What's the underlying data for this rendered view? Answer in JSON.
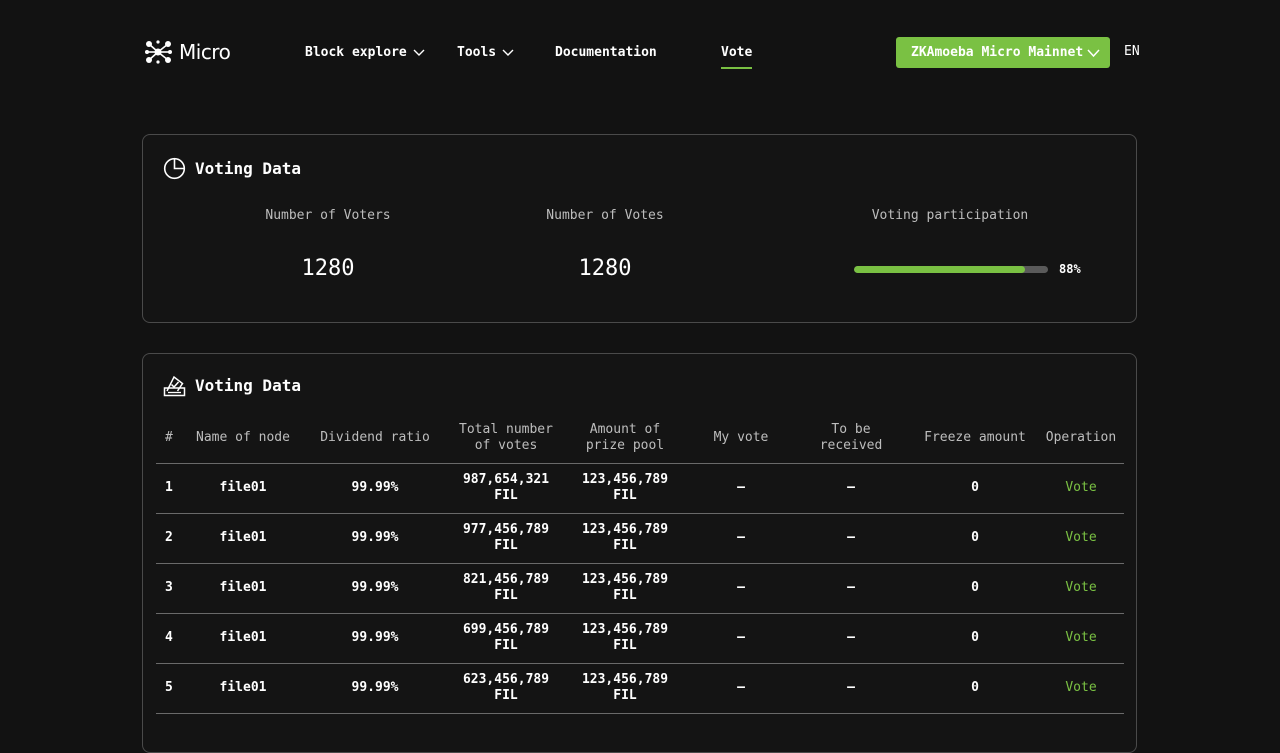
{
  "brand": {
    "name": "Micro"
  },
  "nav": {
    "block_explore": "Block explore",
    "tools": "Tools",
    "documentation": "Documentation",
    "vote": "Vote"
  },
  "network": {
    "selected": "ZKAmoeba Micro Mainnet"
  },
  "language": "EN",
  "colors": {
    "accent": "#7ac143",
    "background": "#121212",
    "border": "#4a4a4a"
  },
  "summary": {
    "title": "Voting Data",
    "icon": "pie-chart-icon",
    "voters_label": "Number of Voters",
    "voters_value": "1280",
    "votes_label": "Number of Votes",
    "votes_value": "1280",
    "participation_label": "Voting participation",
    "participation_percent": 88,
    "participation_text": "88%"
  },
  "table": {
    "title": "Voting Data",
    "icon": "ballot-box-icon",
    "columns": {
      "idx": "#",
      "name": "Name of node",
      "dividend": "Dividend ratio",
      "total_votes_1": "Total number",
      "total_votes_2": "of votes",
      "prize_1": "Amount of",
      "prize_2": "prize pool",
      "my_vote": "My vote",
      "receive_1": "To be",
      "receive_2": "received",
      "freeze": "Freeze amount",
      "operation": "Operation"
    },
    "rows": [
      {
        "idx": "1",
        "name": "file01",
        "dividend": "99.99%",
        "votes_num": "987,654,321",
        "votes_unit": "FIL",
        "prize_num": "123,456,789",
        "prize_unit": "FIL",
        "my_vote": "—",
        "receive": "—",
        "freeze": "0",
        "op": "Vote"
      },
      {
        "idx": "2",
        "name": "file01",
        "dividend": "99.99%",
        "votes_num": "977,456,789",
        "votes_unit": "FIL",
        "prize_num": "123,456,789",
        "prize_unit": "FIL",
        "my_vote": "—",
        "receive": "—",
        "freeze": "0",
        "op": "Vote"
      },
      {
        "idx": "3",
        "name": "file01",
        "dividend": "99.99%",
        "votes_num": "821,456,789",
        "votes_unit": "FIL",
        "prize_num": "123,456,789",
        "prize_unit": "FIL",
        "my_vote": "—",
        "receive": "—",
        "freeze": "0",
        "op": "Vote"
      },
      {
        "idx": "4",
        "name": "file01",
        "dividend": "99.99%",
        "votes_num": "699,456,789",
        "votes_unit": "FIL",
        "prize_num": "123,456,789",
        "prize_unit": "FIL",
        "my_vote": "—",
        "receive": "—",
        "freeze": "0",
        "op": "Vote"
      },
      {
        "idx": "5",
        "name": "file01",
        "dividend": "99.99%",
        "votes_num": "623,456,789",
        "votes_unit": "FIL",
        "prize_num": "123,456,789",
        "prize_unit": "FIL",
        "my_vote": "—",
        "receive": "—",
        "freeze": "0",
        "op": "Vote"
      }
    ]
  }
}
